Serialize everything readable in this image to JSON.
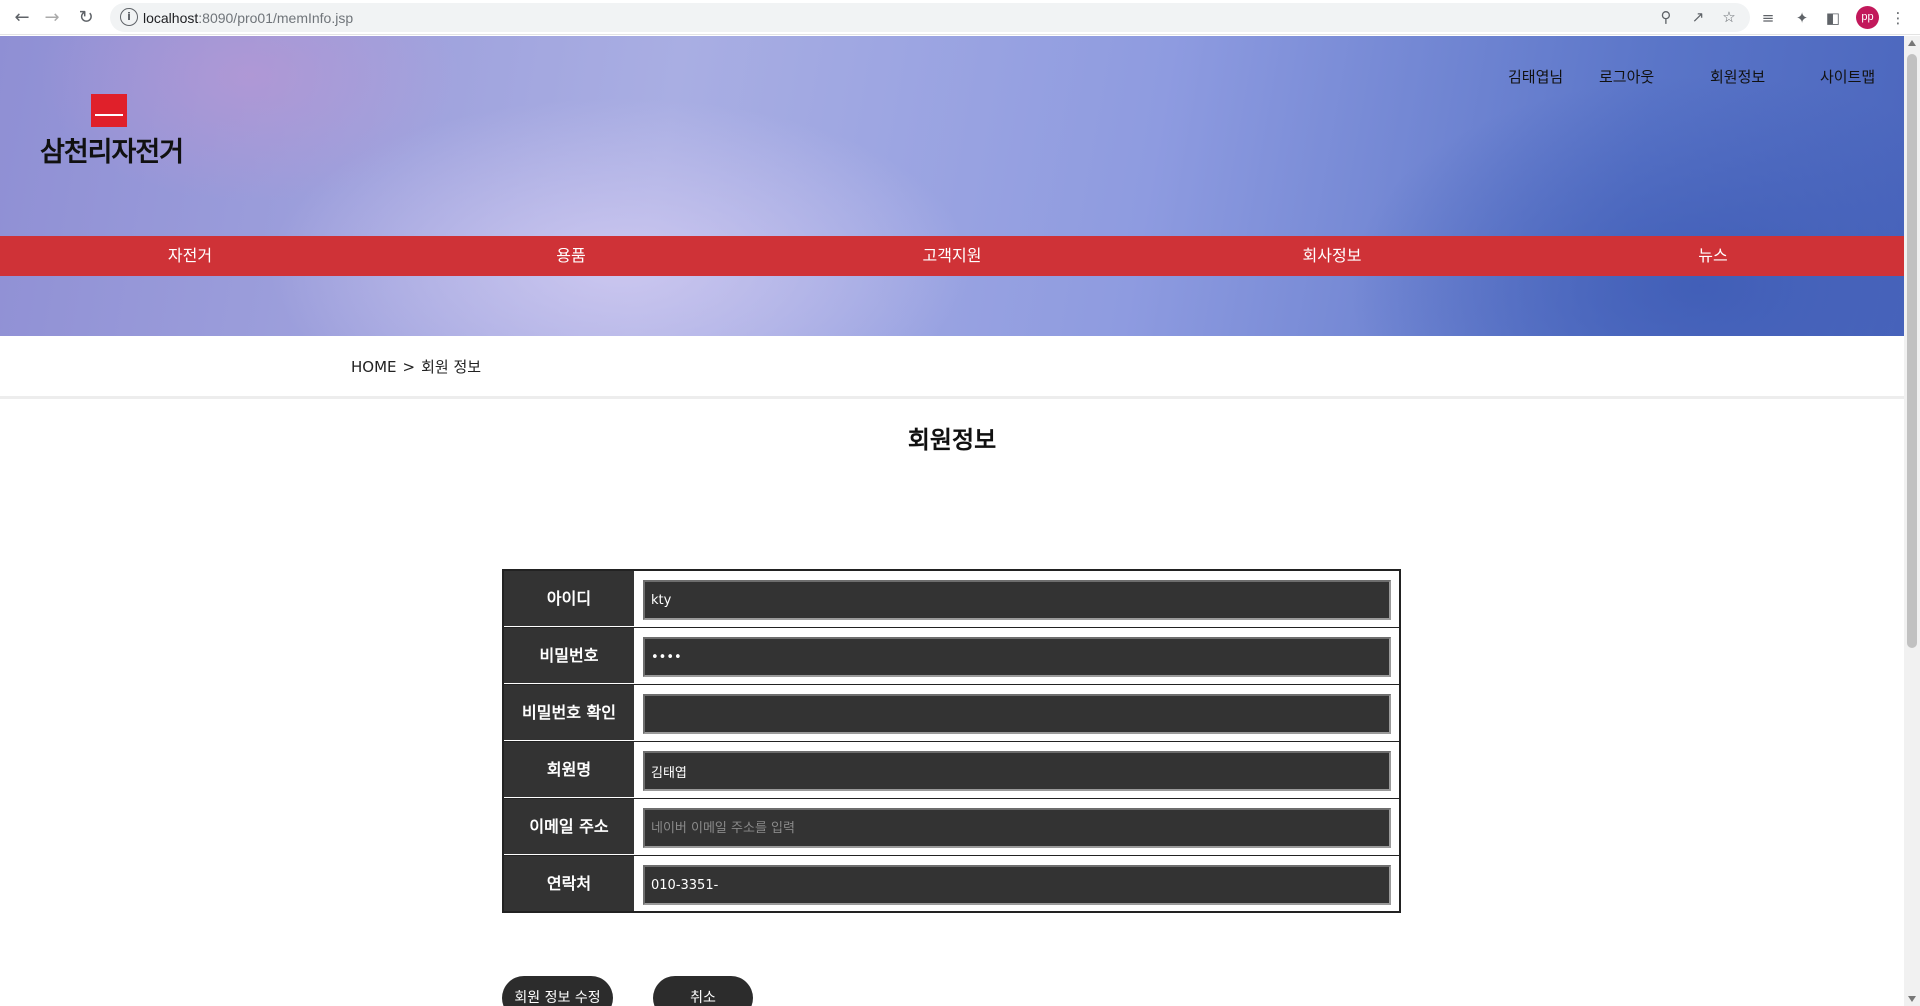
{
  "browser": {
    "url_host": "localhost",
    "url_rest": ":8090/pro01/memInfo.jsp",
    "profile_initials": "pp"
  },
  "site": {
    "logo_text": "삼천리자전거",
    "util_menu": [
      "김태엽님",
      "로그아웃",
      "회원정보",
      "사이트맵"
    ],
    "gnb": [
      "자전거",
      "용품",
      "고객지원",
      "회사정보",
      "뉴스"
    ]
  },
  "breadcrumb": {
    "home": "HOME",
    "separator": ">",
    "current": "회원 정보"
  },
  "page_title": "회원정보",
  "form": {
    "rows": [
      {
        "label": "아이디",
        "value": "kty",
        "placeholder": "",
        "type": "text"
      },
      {
        "label": "비밀번호",
        "value": "••••",
        "placeholder": "",
        "type": "text"
      },
      {
        "label": "비밀번호 확인",
        "value": "",
        "placeholder": "",
        "type": "text"
      },
      {
        "label": "회원명",
        "value": "김태엽",
        "placeholder": "",
        "type": "text"
      },
      {
        "label": "이메일 주소",
        "value": "",
        "placeholder": "네이버 이메일 주소를 입력",
        "type": "text"
      },
      {
        "label": "연락처",
        "value": "010-3351-",
        "placeholder": "",
        "type": "text"
      }
    ]
  },
  "buttons": {
    "edit": "회원 정보 수정",
    "cancel": "취소"
  },
  "colors": {
    "gnb_bg": "#cf3237",
    "field_bg": "#333333",
    "button_bg": "#2c2c2c",
    "logo_red": "#e0202a"
  }
}
